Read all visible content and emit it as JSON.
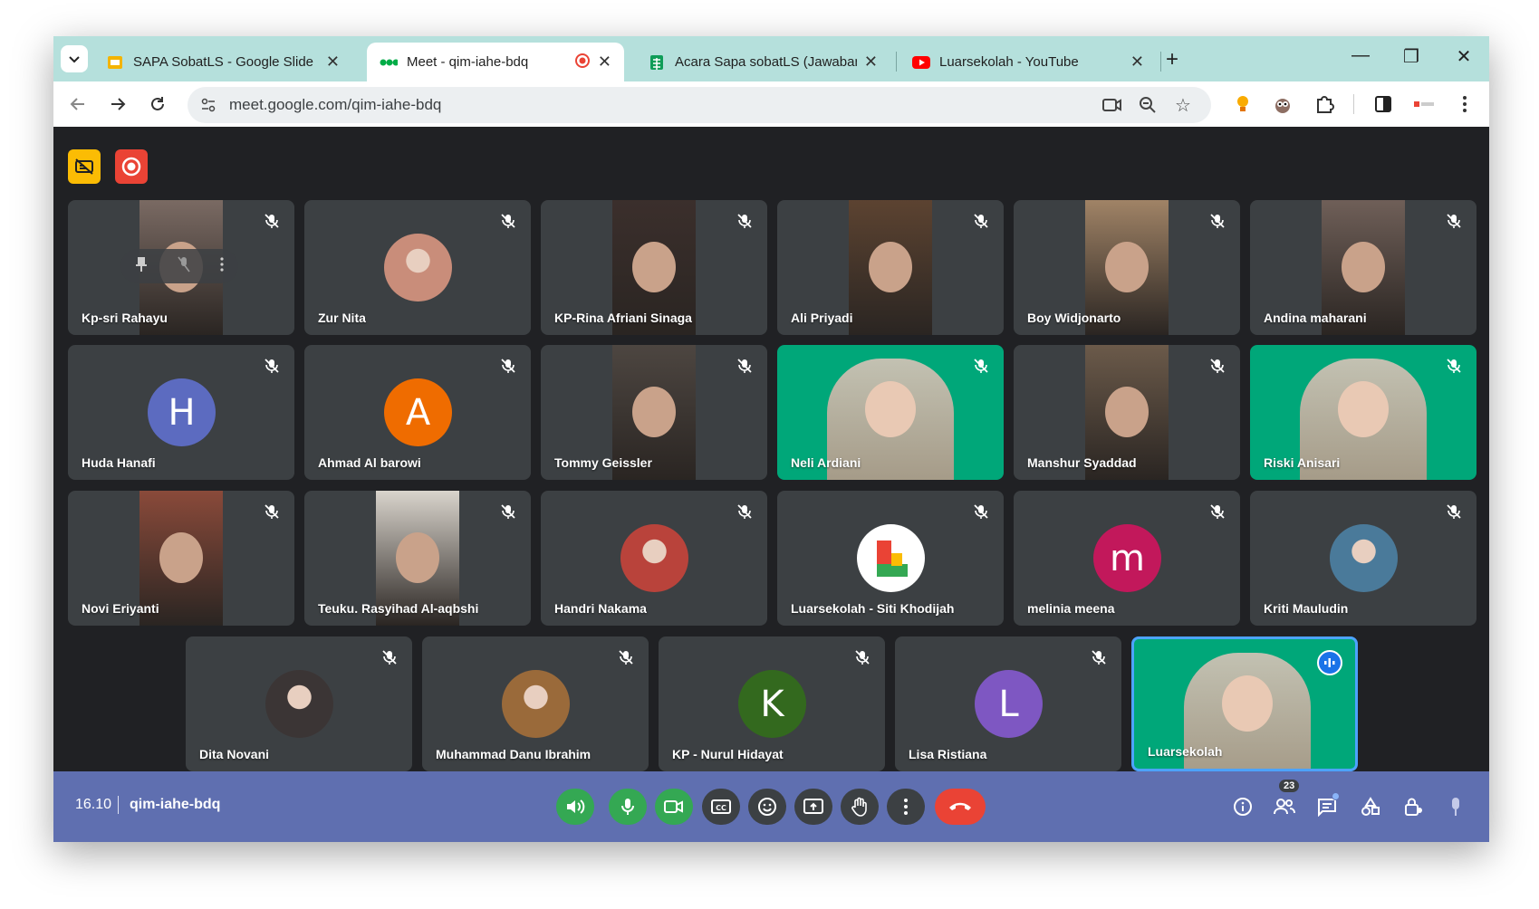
{
  "tabs": [
    {
      "title": "SAPA SobatLS - Google Slide",
      "icon": "slides-icon",
      "color": "#f4b400"
    },
    {
      "title": "Meet - qim-iahe-bdq",
      "icon": "meet-icon",
      "color": "#00ac47",
      "active": true
    },
    {
      "title": "Acara Sapa sobatLS (Jawaban)",
      "icon": "sheets-icon",
      "color": "#0f9d58"
    },
    {
      "title": "Luarsekolah - YouTube",
      "icon": "youtube-icon",
      "color": "#ff0000"
    }
  ],
  "toolbar": {
    "url": "meet.google.com/qim-iahe-bdq"
  },
  "participants": [
    {
      "name": "Kp-sri Rahayu",
      "kind": "video",
      "bg": "#7a6a63"
    },
    {
      "name": "Zur Nita",
      "kind": "photo",
      "bg": "#c98d7a"
    },
    {
      "name": "KP-Rina Afriani Sinaga",
      "kind": "video",
      "bg": "#3b2f2c"
    },
    {
      "name": "Ali Priyadi",
      "kind": "video",
      "bg": "#5c4331"
    },
    {
      "name": "Boy Widjonarto",
      "kind": "video",
      "bg": "#a08366"
    },
    {
      "name": "Andina maharani",
      "kind": "video",
      "bg": "#6f5f58"
    },
    {
      "name": "Huda Hanafi",
      "kind": "letter",
      "letter": "H",
      "bg": "#5c6bc0"
    },
    {
      "name": "Ahmad Al barowi",
      "kind": "letter",
      "letter": "A",
      "bg": "#ef6c00"
    },
    {
      "name": "Tommy Geissler",
      "kind": "video",
      "bg": "#4d4641"
    },
    {
      "name": "Neli Ardiani",
      "kind": "green",
      "bg": "#00a779"
    },
    {
      "name": "Manshur Syaddad",
      "kind": "video",
      "bg": "#6b5a4a"
    },
    {
      "name": "Riski Anisari",
      "kind": "green",
      "bg": "#00a779"
    },
    {
      "name": "Novi Eriyanti",
      "kind": "video",
      "bg": "#8a4a3a"
    },
    {
      "name": "Teuku. Rasyihad Al-aqbshi",
      "kind": "video",
      "bg": "#d9d4cc"
    },
    {
      "name": "Handri Nakama",
      "kind": "photo",
      "bg": "#b9433b"
    },
    {
      "name": "Luarsekolah - Siti Khodijah",
      "kind": "logo",
      "bg": "#ffffff"
    },
    {
      "name": "melinia meena",
      "kind": "letter",
      "letter": "m",
      "bg": "#c2185b"
    },
    {
      "name": "Kriti Mauludin",
      "kind": "photo",
      "bg": "#4a7a9a"
    },
    {
      "name": "Dita Novani",
      "kind": "photo",
      "bg": "#3b3535"
    },
    {
      "name": "Muhammad Danu Ibrahim",
      "kind": "photo",
      "bg": "#9a6a3a"
    },
    {
      "name": "KP - Nurul Hidayat",
      "kind": "letter",
      "letter": "K",
      "bg": "#33691e"
    },
    {
      "name": "Lisa Ristiana",
      "kind": "letter",
      "letter": "L",
      "bg": "#7e57c2"
    },
    {
      "name": "Luarsekolah",
      "kind": "green-speaking",
      "bg": "#00a779"
    }
  ],
  "bottombar": {
    "time": "16.10",
    "meeting_code": "qim-iahe-bdq",
    "people_count": "23"
  },
  "colors": {
    "end_call": "#ea4335",
    "active_green": "#34a853",
    "bottom_bar": "#5f6fb0",
    "speaking_border": "#4da3ff"
  }
}
